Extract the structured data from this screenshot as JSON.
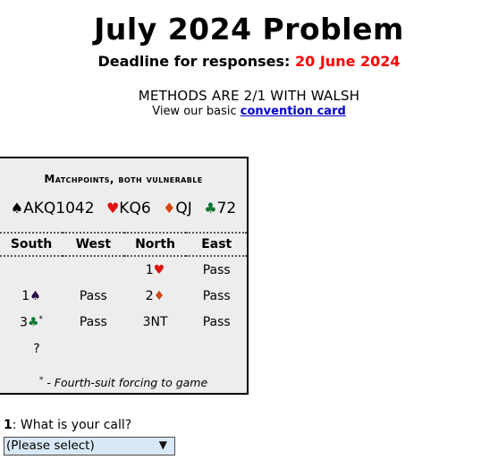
{
  "header": {
    "title": "July 2024 Problem",
    "deadline_label": "Deadline for responses:",
    "deadline_date": "20 June 2024",
    "methods": "METHODS ARE 2/1 WITH WALSH",
    "convention_prefix": "View our basic",
    "convention_link": "convention card"
  },
  "problem": {
    "conditions": "Matchpoints, both vulnerable",
    "hand": [
      {
        "suit_icon": "spade-icon",
        "symbol": "♠",
        "cards": "AKQ1042"
      },
      {
        "suit_icon": "heart-icon",
        "symbol": "♥",
        "cards": "KQ6"
      },
      {
        "suit_icon": "diamond-icon",
        "symbol": "♦",
        "cards": "QJ"
      },
      {
        "suit_icon": "club-icon",
        "symbol": "♣",
        "cards": "72"
      }
    ],
    "auction_headers": [
      "South",
      "West",
      "North",
      "East"
    ],
    "auction_rows": [
      {
        "south": "",
        "west": "",
        "north_level": "1",
        "north_symbol": "♥",
        "east": "Pass"
      },
      {
        "south_level": "1",
        "south_symbol": "♠",
        "west": "Pass",
        "north_level": "2",
        "north_symbol": "♦",
        "east": "Pass"
      },
      {
        "south_level": "3",
        "south_symbol": "♣",
        "south_star": "*",
        "west": "Pass",
        "north": "3NT",
        "east": "Pass"
      }
    ],
    "your_turn": "?",
    "footnote_star": "*",
    "footnote_text": "- Fourth-suit forcing to game"
  },
  "question": {
    "number": "1",
    "prompt": ": What is your call?",
    "select_value": "(Please select)"
  },
  "colors": {
    "spade": "#000000",
    "heart": "#e01111",
    "diamond": "#d1470f",
    "club": "#117733",
    "bid_spade": "#2b0a47",
    "deadline": "#ff0000",
    "link": "#0000cc",
    "box_bg": "#ededed",
    "select_bg": "#d9e8f6"
  }
}
